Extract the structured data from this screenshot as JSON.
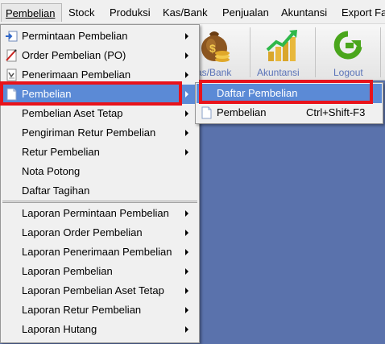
{
  "menubar": {
    "items": [
      {
        "label": "Pembelian",
        "active": true
      },
      {
        "label": "Stock"
      },
      {
        "label": "Produksi"
      },
      {
        "label": "Kas/Bank"
      },
      {
        "label": "Penjualan"
      },
      {
        "label": "Akuntansi"
      },
      {
        "label": "Export Fa"
      }
    ]
  },
  "toolbar": {
    "items": [
      {
        "label": "as/Bank",
        "icon": "money-bag-icon"
      },
      {
        "label": "Akuntansi",
        "icon": "chart-growth-icon"
      },
      {
        "label": "Logout",
        "icon": "logout-arrow-icon"
      }
    ]
  },
  "dropdown": {
    "items": [
      {
        "label": "Permintaan Pembelian",
        "icon": "request-icon",
        "submenu": true
      },
      {
        "label": "Order Pembelian (PO)",
        "icon": "order-icon",
        "submenu": true
      },
      {
        "label": "Penerimaan Pembelian",
        "icon": "receipt-icon",
        "submenu": true
      },
      {
        "label": "Pembelian",
        "icon": "document-icon",
        "submenu": true,
        "highlighted": true
      },
      {
        "label": "Pembelian Aset Tetap",
        "submenu": true
      },
      {
        "label": "Pengiriman Retur Pembelian",
        "submenu": true
      },
      {
        "label": "Retur Pembelian",
        "submenu": true
      },
      {
        "label": "Nota Potong",
        "submenu": false
      },
      {
        "label": "Daftar Tagihan",
        "submenu": false
      },
      {
        "label": "Laporan Permintaan Pembelian",
        "submenu": true
      },
      {
        "label": "Laporan Order Pembelian",
        "submenu": true
      },
      {
        "label": "Laporan Penerimaan Pembelian",
        "submenu": true
      },
      {
        "label": "Laporan Pembelian",
        "submenu": true
      },
      {
        "label": "Laporan Pembelian Aset Tetap",
        "submenu": true
      },
      {
        "label": "Laporan Retur Pembelian",
        "submenu": true
      },
      {
        "label": "Laporan Hutang",
        "submenu": true
      }
    ]
  },
  "submenu": {
    "items": [
      {
        "label": "Daftar Pembelian",
        "shortcut": "",
        "highlighted": true
      },
      {
        "label": "Pembelian",
        "shortcut": "Ctrl+Shift-F3",
        "icon": "document-icon"
      }
    ]
  },
  "colors": {
    "menu_bg": "#f0f0f0",
    "highlight": "#5b8ad6",
    "desktop": "#5a72ac",
    "annotation_red": "#e8131b",
    "toolbar_label": "#5a73b8"
  }
}
